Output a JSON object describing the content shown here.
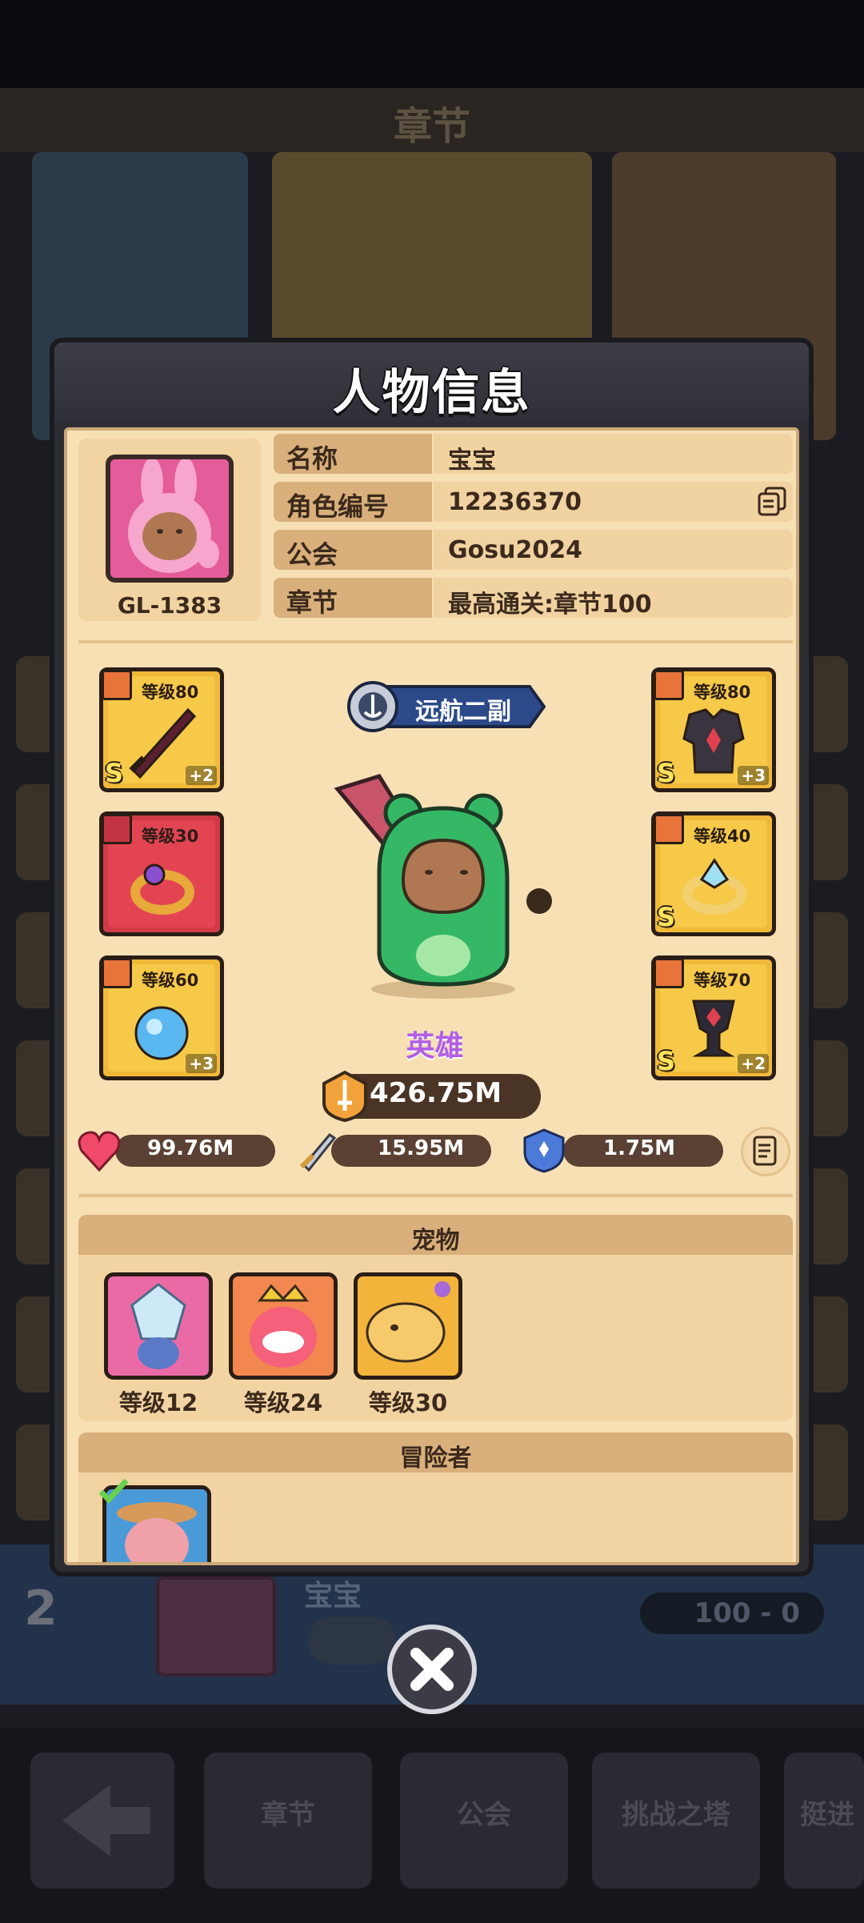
{
  "background": {
    "title": "章节",
    "rank": "2",
    "player_name": "宝宝",
    "score": "100 - 0",
    "nav": [
      "章节",
      "公会",
      "挑战之塔",
      "挺进"
    ]
  },
  "dialog": {
    "title": "人物信息",
    "avatar_id": "GL-1383",
    "info": [
      {
        "label": "名称",
        "value": "宝宝"
      },
      {
        "label": "角色编号",
        "value": "12236370"
      },
      {
        "label": "公会",
        "value": "Gosu2024"
      },
      {
        "label": "章节",
        "value": "最高通关:章节100"
      }
    ],
    "title_badge": "远航二副",
    "hero_name": "英雄",
    "power": "426.75M",
    "stats": {
      "hp": "99.76M",
      "attack": "15.95M",
      "defense": "1.75M"
    },
    "equipment": [
      {
        "slot": "weapon",
        "level": "等级80",
        "rank": "S",
        "plus": "+2"
      },
      {
        "slot": "ring",
        "level": "等级30",
        "rank": "",
        "plus": ""
      },
      {
        "slot": "necklace",
        "level": "等级60",
        "rank": "",
        "plus": "+3"
      },
      {
        "slot": "armor",
        "level": "等级80",
        "rank": "S",
        "plus": "+3"
      },
      {
        "slot": "ring",
        "level": "等级40",
        "rank": "S",
        "plus": ""
      },
      {
        "slot": "necklace",
        "level": "等级70",
        "rank": "S",
        "plus": "+2"
      }
    ],
    "pets_section": "宠物",
    "pets": [
      {
        "level": "等级12",
        "color": "#ea6aa6"
      },
      {
        "level": "等级24",
        "color": "#f2874f"
      },
      {
        "level": "等级30",
        "color": "#f2b43a"
      }
    ],
    "adventurer_section": "冒险者"
  },
  "colors": {
    "panel_bg": "#f7e0b4",
    "section_head": "#d9b07c",
    "hero_name": "#b25ee6"
  }
}
